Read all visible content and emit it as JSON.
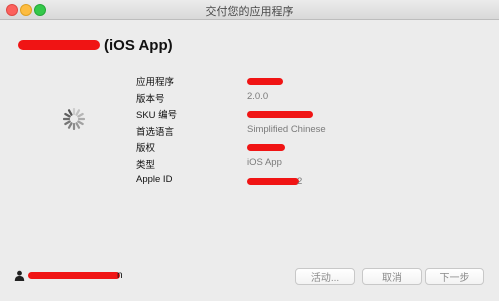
{
  "window": {
    "title": "交付您的应用程序"
  },
  "app": {
    "suffix": "(iOS App)"
  },
  "info": {
    "rows": [
      {
        "label": "应用程序",
        "value": "",
        "redacted": true,
        "redact_width": 36
      },
      {
        "label": "版本号",
        "value": "2.0.0",
        "redacted": false
      },
      {
        "label": "SKU 编号",
        "value": "",
        "redacted": true,
        "redact_width": 66
      },
      {
        "label": "首选语言",
        "value": "Simplified Chinese",
        "redacted": false
      },
      {
        "label": "版权",
        "value": "",
        "redacted": true,
        "redact_width": 38
      },
      {
        "label": "类型",
        "value": "iOS App",
        "redacted": false
      },
      {
        "label": "Apple ID",
        "value": "",
        "redacted": true,
        "redact_width": 52,
        "trailing": "2"
      }
    ]
  },
  "footer": {
    "account_tail": "n",
    "buttons": {
      "activity": "活动...",
      "cancel": "取消",
      "next": "下一步"
    }
  },
  "colors": {
    "redaction": "#f01414",
    "value_text": "#7a7a7a"
  }
}
